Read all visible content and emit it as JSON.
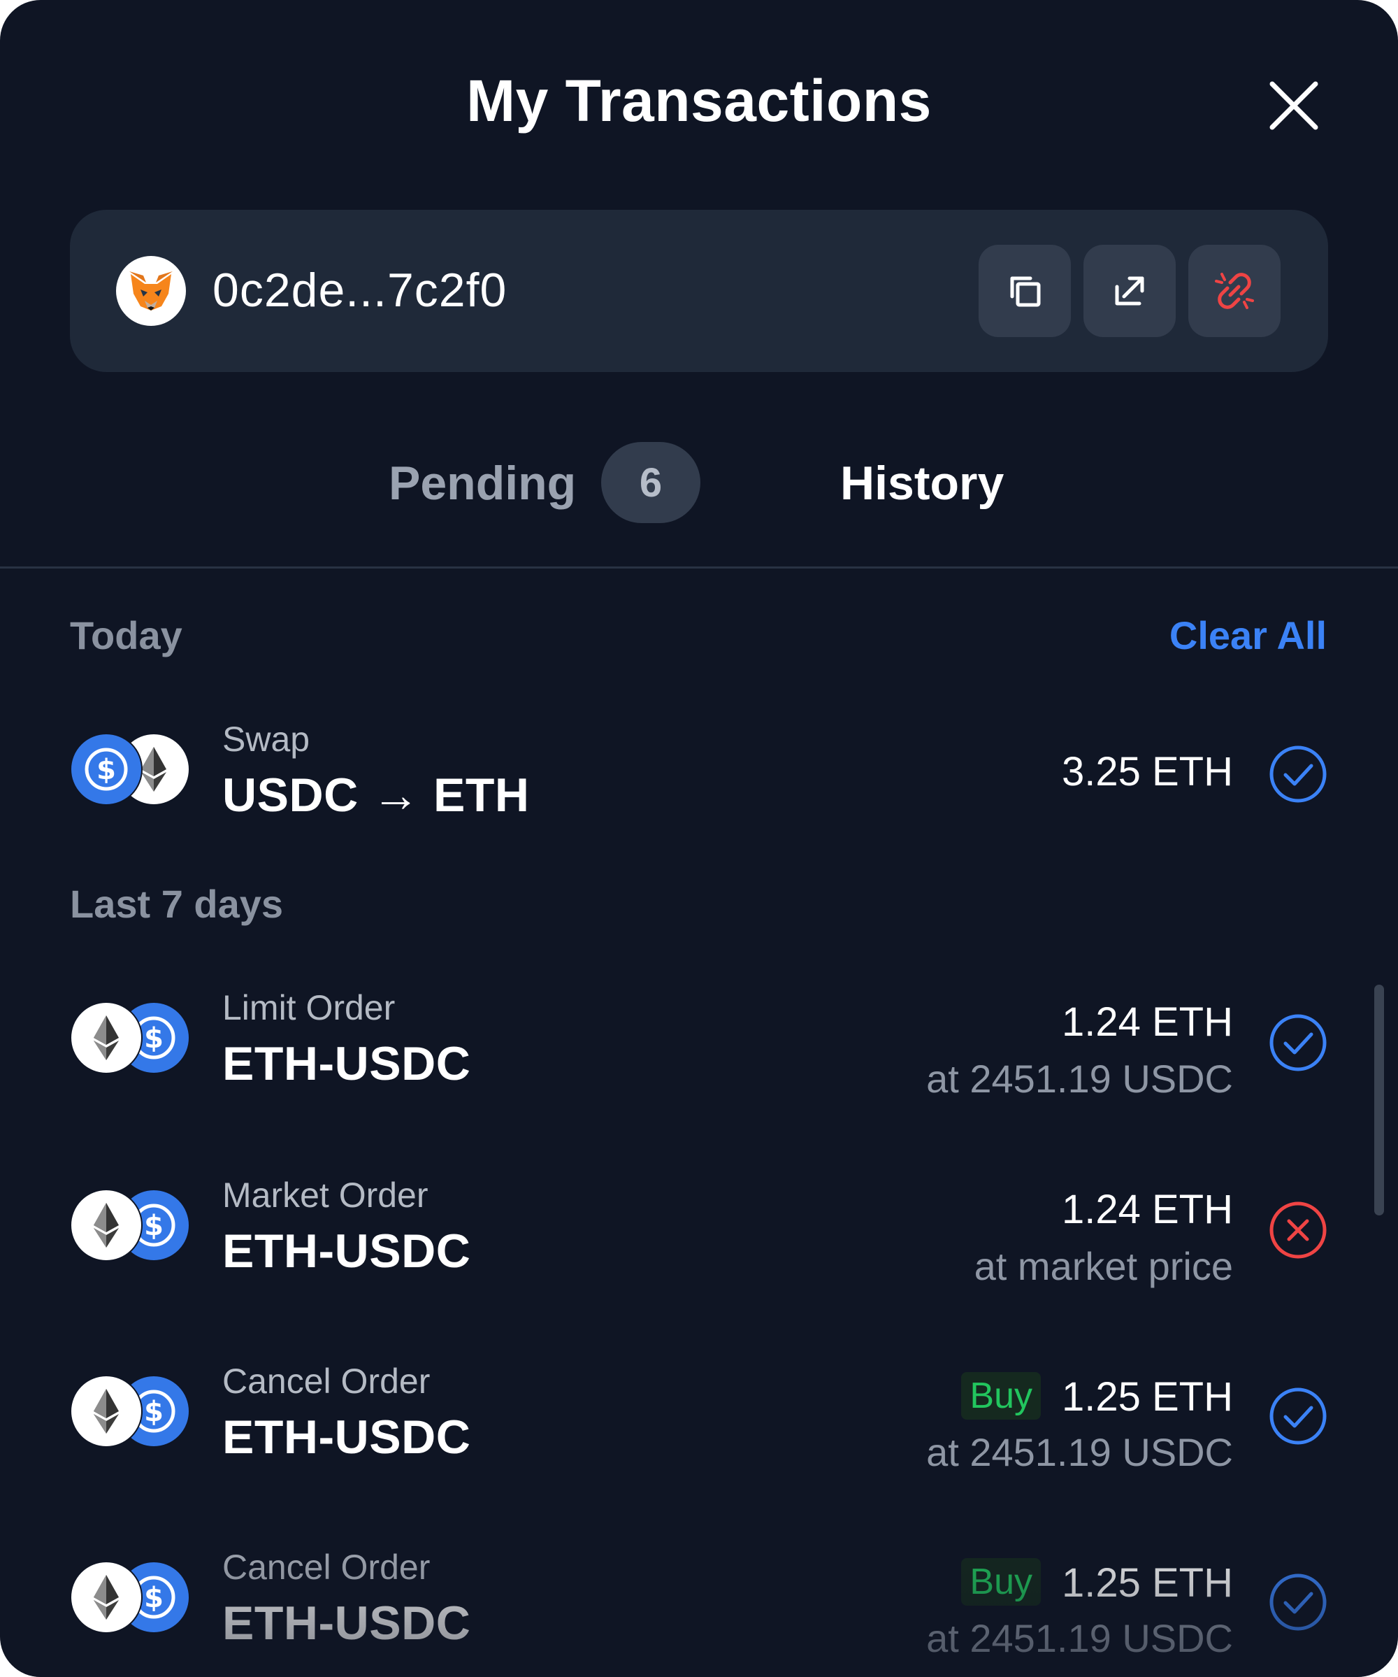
{
  "header": {
    "title": "My Transactions"
  },
  "wallet": {
    "address": "0c2de...7c2f0"
  },
  "tabs": {
    "pending_label": "Pending",
    "pending_count": "6",
    "history_label": "History"
  },
  "sections": {
    "today": "Today",
    "last7": "Last 7 days",
    "clear_all": "Clear All"
  },
  "transactions": [
    {
      "type": "Swap",
      "pair": "USDC → ETH",
      "amount": "3.25 ETH",
      "sub": "",
      "badge": "",
      "status": "success"
    },
    {
      "type": "Limit Order",
      "pair": "ETH-USDC",
      "amount": "1.24 ETH",
      "sub": "at 2451.19 USDC",
      "badge": "",
      "status": "success"
    },
    {
      "type": "Market Order",
      "pair": "ETH-USDC",
      "amount": "1.24 ETH",
      "sub": "at market price",
      "badge": "",
      "status": "failed"
    },
    {
      "type": "Cancel Order",
      "pair": "ETH-USDC",
      "amount": "1.25 ETH",
      "sub": "at 2451.19 USDC",
      "badge": "Buy",
      "status": "success"
    },
    {
      "type": "Cancel Order",
      "pair": "ETH-USDC",
      "amount": "1.25 ETH",
      "sub": "at 2451.19 USDC",
      "badge": "Buy",
      "status": "success"
    }
  ],
  "icons": {
    "close": "close-icon",
    "copy": "copy-icon",
    "external": "external-link-icon",
    "disconnect": "unlink-icon",
    "success": "check-circle-icon",
    "failed": "x-circle-icon"
  },
  "colors": {
    "background": "#0f1524",
    "card": "#1f2939",
    "accent": "#3b82f6",
    "error": "#ef4444",
    "buy": "#22c55e"
  }
}
